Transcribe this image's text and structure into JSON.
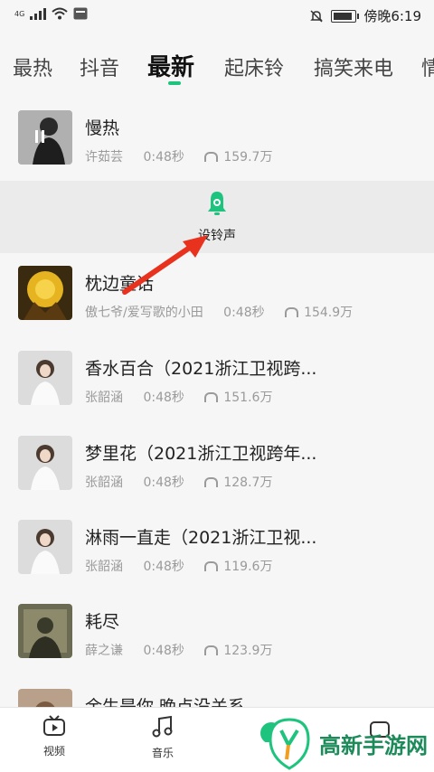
{
  "status_bar": {
    "network": "4G",
    "time_text": "傍晚6:19"
  },
  "tabs": [
    {
      "label": "最热"
    },
    {
      "label": "抖音"
    },
    {
      "label": "最新",
      "active": true
    },
    {
      "label": "起床铃"
    },
    {
      "label": "搞笑来电"
    },
    {
      "label": "情"
    }
  ],
  "songs": [
    {
      "title": "慢热",
      "artist": "许茹芸",
      "duration": "0:48秒",
      "plays": "159.7万"
    },
    {
      "title": "枕边童话",
      "artist": "傲七爷/爱写歌的小田",
      "duration": "0:48秒",
      "plays": "154.9万"
    },
    {
      "title": "香水百合（2021浙江卫视跨...",
      "artist": "张韶涵",
      "duration": "0:48秒",
      "plays": "151.6万"
    },
    {
      "title": "梦里花（2021浙江卫视跨年...",
      "artist": "张韶涵",
      "duration": "0:48秒",
      "plays": "128.7万"
    },
    {
      "title": "淋雨一直走（2021浙江卫视...",
      "artist": "张韶涵",
      "duration": "0:48秒",
      "plays": "119.6万"
    },
    {
      "title": "耗尽",
      "artist": "薛之谦",
      "duration": "0:48秒",
      "plays": "123.9万"
    },
    {
      "title": "余生是你 晚点没关系",
      "artist": "",
      "duration": "",
      "plays": ""
    }
  ],
  "expanded_action": {
    "label": "设铃声"
  },
  "bottom_nav": [
    {
      "label": "视频"
    },
    {
      "label": "音乐"
    }
  ],
  "watermark": {
    "text": "高新手游网"
  },
  "colors": {
    "accent": "#1ec47d",
    "arrow": "#e8321e"
  }
}
